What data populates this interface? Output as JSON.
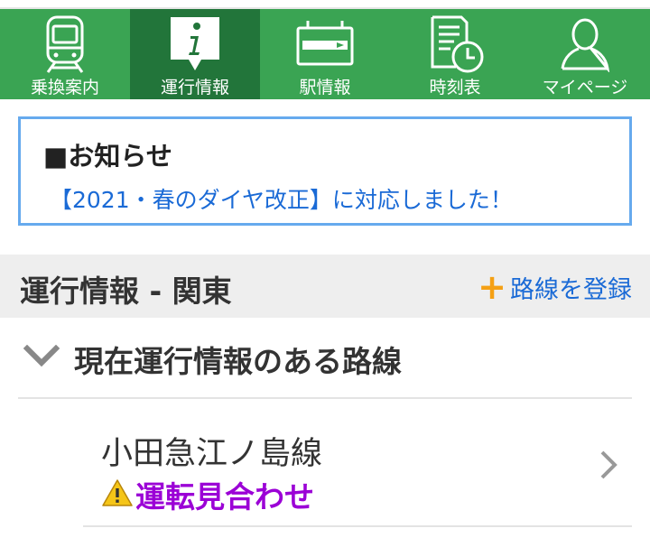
{
  "nav": {
    "items": [
      {
        "label": "乗換案内",
        "icon": "train-icon",
        "active": false
      },
      {
        "label": "運行情報",
        "icon": "info-icon",
        "active": true
      },
      {
        "label": "駅情報",
        "icon": "station-sign-icon",
        "active": false
      },
      {
        "label": "時刻表",
        "icon": "timetable-icon",
        "active": false
      },
      {
        "label": "マイページ",
        "icon": "person-icon",
        "active": false
      }
    ]
  },
  "notice": {
    "title": "■お知らせ",
    "link_text": "【2021・春のダイヤ改正】に対応しました！"
  },
  "section": {
    "title": "運行情報 - 関東",
    "register_label": "路線を登録",
    "register_icon": "plus-icon"
  },
  "group": {
    "title": "現在運行情報のある路線",
    "toggle_icon": "chevron-down-icon"
  },
  "lines": [
    {
      "name": "小田急江ノ島線",
      "status": "運転見合わせ",
      "status_icon": "warning-icon",
      "status_color": "#9b00d6"
    }
  ],
  "colors": {
    "nav_bg": "#3aa453",
    "nav_active_bg": "#22753a",
    "link": "#1a6ad6",
    "notice_border": "#66aaee",
    "plus": "#f5a014",
    "status": "#9b00d6"
  }
}
